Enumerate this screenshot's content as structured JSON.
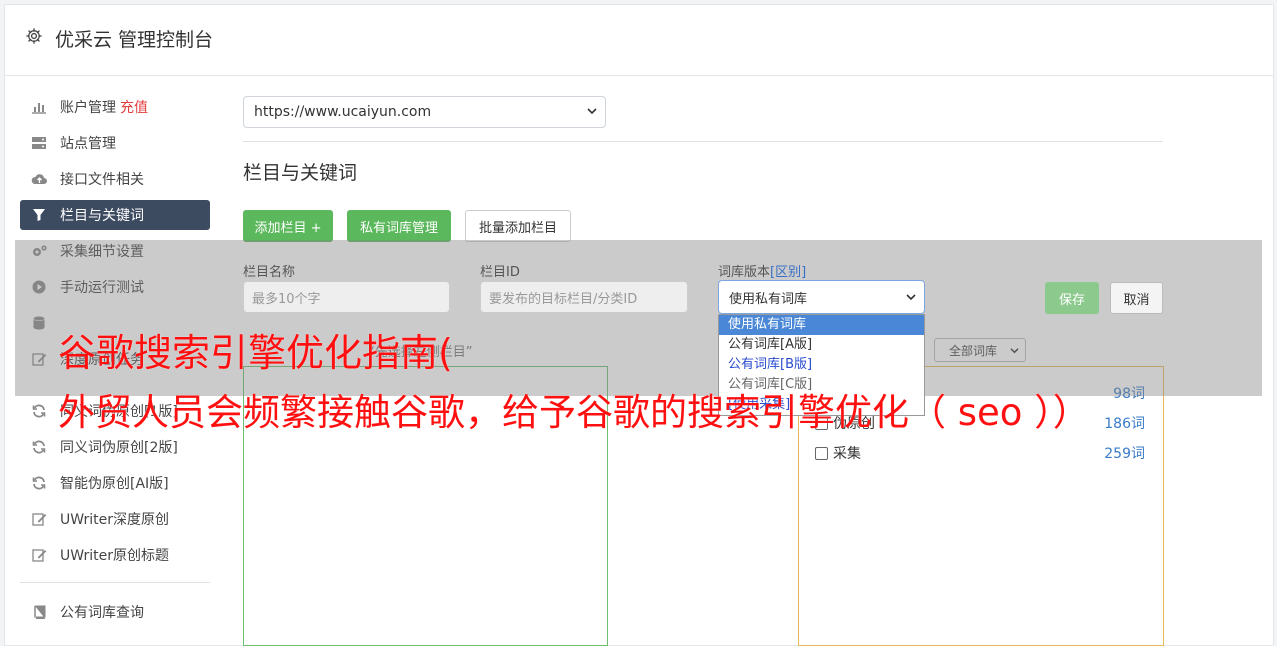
{
  "header": {
    "title": "优采云 管理控制台",
    "icon": "gear-icon"
  },
  "sidebar": {
    "items": [
      {
        "label": "账户管理",
        "extra": "充值",
        "icon": "bar-chart-icon"
      },
      {
        "label": "站点管理",
        "icon": "server-icon"
      },
      {
        "label": "接口文件相关",
        "icon": "cloud-upload-icon"
      },
      {
        "label": "栏目与关键词",
        "icon": "filter-icon",
        "active": true
      },
      {
        "label": "采集细节设置",
        "icon": "cogs-icon"
      },
      {
        "label": "手动运行测试",
        "icon": "play-icon"
      },
      {
        "label": "",
        "icon": "database-icon"
      },
      {
        "label": "深度原创任务",
        "icon": "edit-icon"
      },
      {
        "label": "同义词伪原创[1版]",
        "icon": "refresh-icon"
      },
      {
        "label": "同义词伪原创[2版]",
        "icon": "refresh-icon"
      },
      {
        "label": "智能伪原创[AI版]",
        "icon": "refresh-icon"
      },
      {
        "label": "UWriter深度原创",
        "icon": "edit-icon"
      },
      {
        "label": "UWriter原创标题",
        "icon": "edit-icon"
      }
    ],
    "bottom_items": [
      {
        "label": "公有词库查询",
        "icon": "book-icon"
      }
    ]
  },
  "main": {
    "site_select_value": "https://www.ucaiyun.com",
    "section_title": "栏目与关键词",
    "buttons": {
      "add_column": "添加栏目 +",
      "private_lib": "私有词库管理",
      "batch_add": "批量添加栏目"
    }
  },
  "form": {
    "column_name_label": "栏目名称",
    "column_name_placeholder": "最多10个字",
    "column_id_label": "栏目ID",
    "column_id_placeholder": "要发布的目标栏目/分类ID",
    "lib_version_label": "词库版本",
    "lib_version_link": "[区别]",
    "lib_version_value": "使用私有词库",
    "dropdown_options": [
      "使用私有词库",
      "公有词库[A版]",
      "公有词库[B版]",
      "公有词库[C版]",
      "[使用采集]"
    ],
    "save": "保存",
    "cancel": "取消",
    "hint": "“先选择左侧栏目”",
    "filter_value": "全部词库"
  },
  "libraries": [
    {
      "name": "",
      "count": "98词"
    },
    {
      "name": "伪原创",
      "count": "186词"
    },
    {
      "name": "采集",
      "count": "259词"
    }
  ],
  "banner": {
    "line1": "谷歌搜索引擎优化指南(",
    "line2": "外贸人员会频繁接触谷歌，给予谷歌的搜索引擎优化（ seo ））"
  }
}
